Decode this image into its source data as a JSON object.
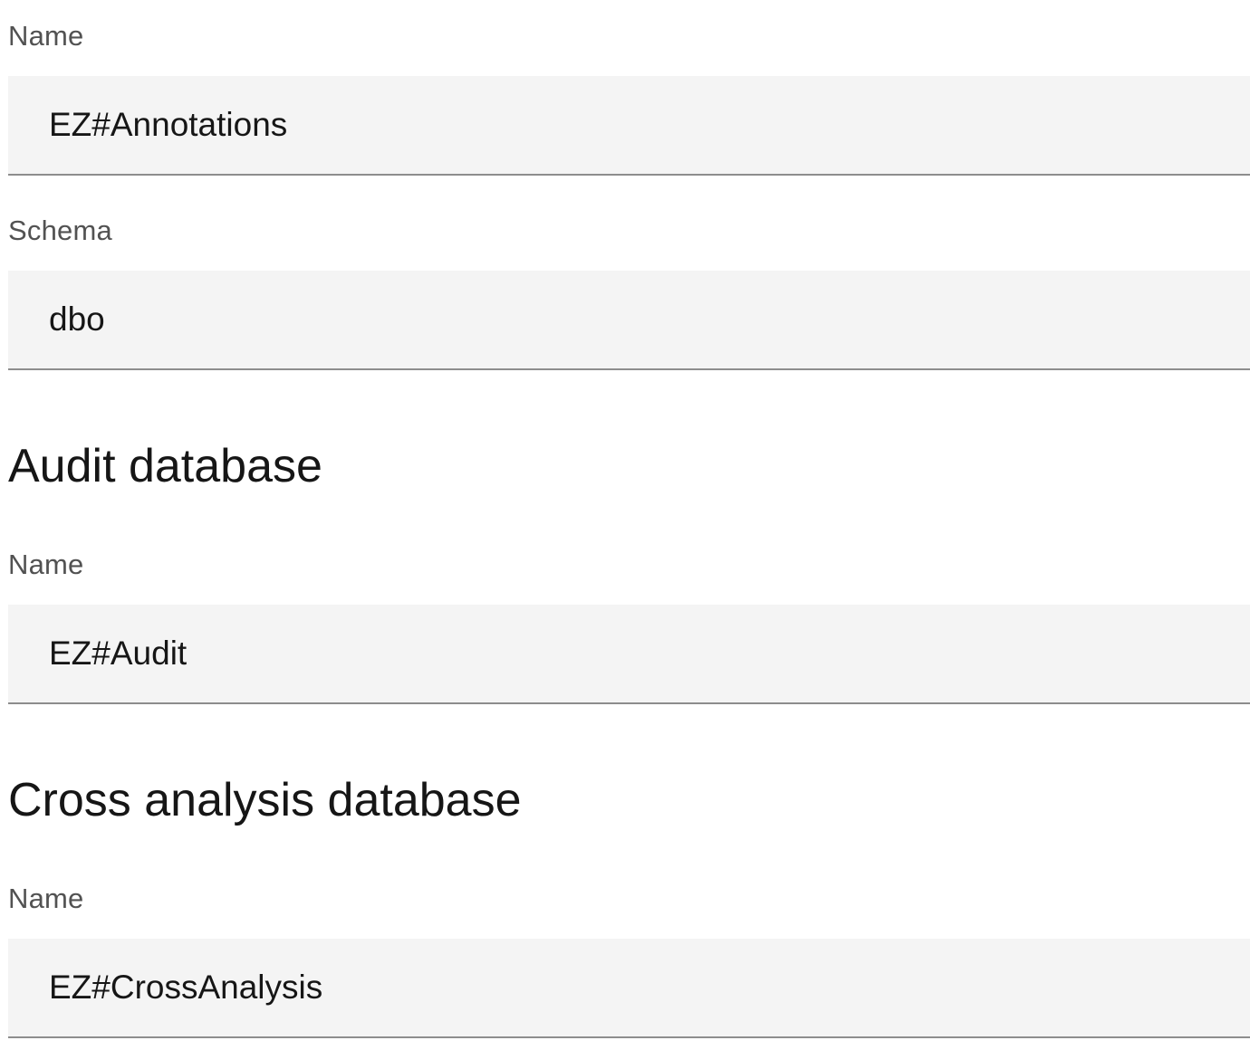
{
  "annotations": {
    "name_label": "Name",
    "name_value": "EZ#Annotations",
    "schema_label": "Schema",
    "schema_value": "dbo"
  },
  "audit": {
    "title": "Audit database",
    "name_label": "Name",
    "name_value": "EZ#Audit"
  },
  "cross_analysis": {
    "title": "Cross analysis database",
    "name_label": "Name",
    "name_value": "EZ#CrossAnalysis"
  },
  "colors": {
    "label": "#525252",
    "field_background": "#f4f4f4",
    "field_border": "#8d8d8d",
    "text": "#161616"
  }
}
